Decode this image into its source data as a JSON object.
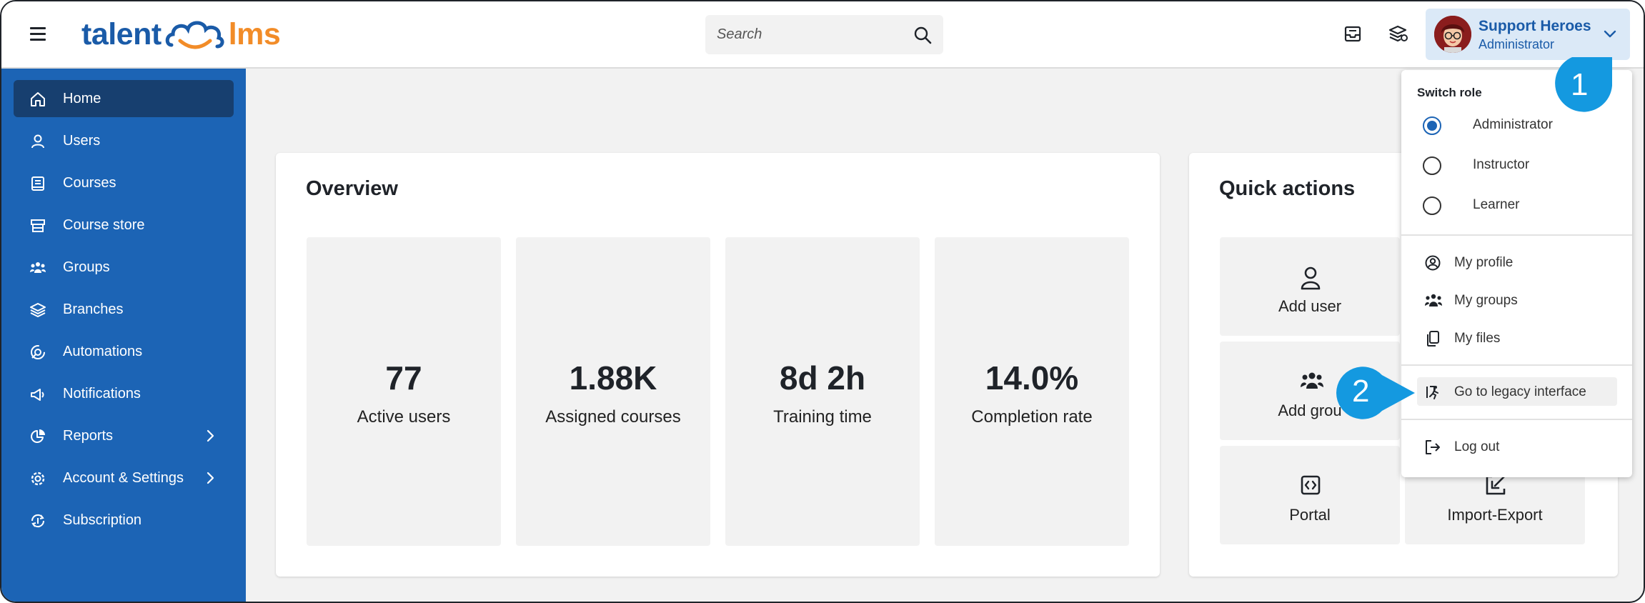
{
  "colors": {
    "brand_blue": "#1c64b5",
    "active_nav": "#173f6f",
    "logo_orange": "#f28c28",
    "callout": "#1499e0"
  },
  "header": {
    "logo_left": "talent",
    "logo_right": "lms",
    "search_placeholder": "Search",
    "icons": [
      "inbox-icon",
      "courses-stack-icon"
    ],
    "user": {
      "name": "Support Heroes",
      "role": "Administrator"
    }
  },
  "sidebar": {
    "items": [
      {
        "label": "Home",
        "icon": "home-icon",
        "active": true
      },
      {
        "label": "Users",
        "icon": "user-icon"
      },
      {
        "label": "Courses",
        "icon": "book-icon"
      },
      {
        "label": "Course store",
        "icon": "store-icon"
      },
      {
        "label": "Groups",
        "icon": "groups-icon"
      },
      {
        "label": "Branches",
        "icon": "branches-icon"
      },
      {
        "label": "Automations",
        "icon": "automations-icon"
      },
      {
        "label": "Notifications",
        "icon": "megaphone-icon"
      },
      {
        "label": "Reports",
        "icon": "pie-chart-icon",
        "has_submenu": true
      },
      {
        "label": "Account & Settings",
        "icon": "gear-icon",
        "has_submenu": true
      },
      {
        "label": "Subscription",
        "icon": "subscription-icon"
      }
    ]
  },
  "overview": {
    "title": "Overview",
    "stats": [
      {
        "value": "77",
        "label": "Active users"
      },
      {
        "value": "1.88K",
        "label": "Assigned courses"
      },
      {
        "value": "8d 2h",
        "label": "Training time"
      },
      {
        "value": "14.0%",
        "label": "Completion rate"
      }
    ]
  },
  "quick_actions": {
    "title": "Quick actions",
    "items": [
      {
        "label": "Add user",
        "icon": "add-user-icon"
      },
      {
        "label": "Add group",
        "visible_label": "Add grou",
        "icon": "add-group-icon"
      },
      {
        "label": "Portal",
        "icon": "portal-icon"
      },
      {
        "label": "Import-Export",
        "icon": "import-export-icon"
      }
    ]
  },
  "dropdown": {
    "switch_role_title": "Switch role",
    "roles": [
      {
        "label": "Administrator",
        "selected": true
      },
      {
        "label": "Instructor",
        "selected": false
      },
      {
        "label": "Learner",
        "selected": false
      }
    ],
    "menu": [
      {
        "label": "My profile",
        "icon": "profile-icon"
      },
      {
        "label": "My groups",
        "icon": "groups-icon"
      },
      {
        "label": "My files",
        "icon": "files-icon"
      }
    ],
    "legacy": {
      "label": "Go to legacy interface",
      "icon": "legacy-interface-icon"
    },
    "logout": {
      "label": "Log out",
      "icon": "logout-icon"
    }
  },
  "callouts": {
    "one": "1",
    "two": "2"
  }
}
